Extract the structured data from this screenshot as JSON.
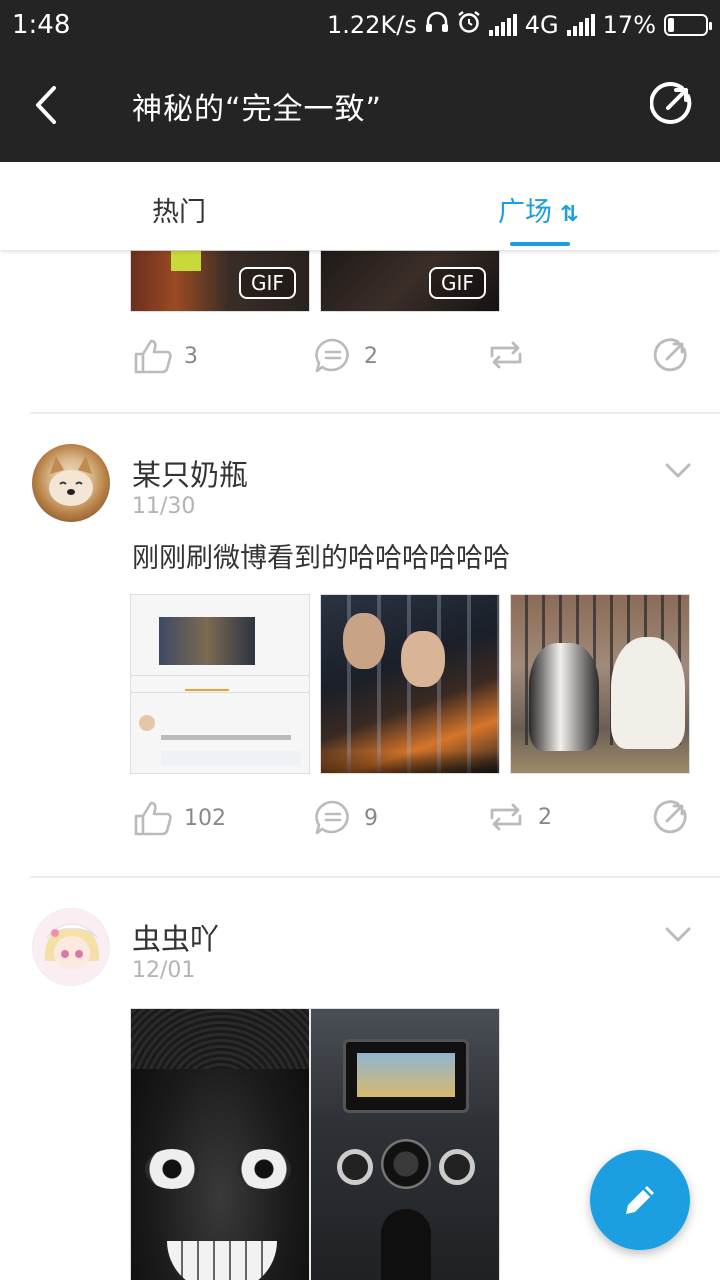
{
  "status_bar": {
    "time": "1:48",
    "network_speed": "1.22K/s",
    "network_type": "4G",
    "battery_percent": "17%",
    "battery_level": 0.17,
    "icons": [
      "headphones-icon",
      "alarm-icon",
      "signal-icon",
      "signal-icon",
      "battery-charging-icon"
    ]
  },
  "header": {
    "title": "神秘的“完全一致”",
    "back_icon": "back-arrow-icon",
    "share_icon": "share-icon"
  },
  "tabs": [
    {
      "label": "热门",
      "active": false
    },
    {
      "label": "广场",
      "active": true,
      "sort_glyph": "⇅"
    }
  ],
  "colors": {
    "accent": "#1c9fe0",
    "topbar": "#242424"
  },
  "posts": [
    {
      "partial": true,
      "images": [
        {
          "badge": "GIF"
        },
        {
          "badge": "GIF"
        }
      ],
      "likes": "3",
      "comments": "2",
      "reposts": ""
    },
    {
      "author": "某只奶瓶",
      "date": "11/30",
      "text": "刚刚刷微博看到的哈哈哈哈哈哈",
      "likes": "102",
      "comments": "9",
      "reposts": "2"
    },
    {
      "author": "虫虫吖",
      "date": "12/01",
      "text": ""
    }
  ],
  "fab": {
    "icon": "pencil-icon"
  }
}
